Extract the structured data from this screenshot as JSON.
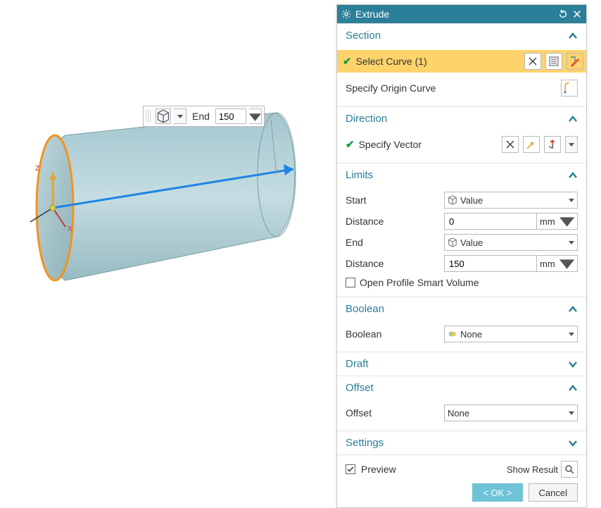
{
  "floatbox": {
    "label": "End",
    "value": "150",
    "icon": "cube-icon"
  },
  "dialog": {
    "title": "Extrude",
    "section": {
      "title": "Section",
      "expanded": true,
      "selectCurve": {
        "label": "Select Curve (1)"
      },
      "originCurve": {
        "label": "Specify Origin Curve"
      }
    },
    "direction": {
      "title": "Direction",
      "expanded": true,
      "specifyVector": {
        "label": "Specify Vector"
      }
    },
    "limits": {
      "title": "Limits",
      "expanded": true,
      "start": {
        "label": "Start",
        "type": "Value"
      },
      "startDistance": {
        "label": "Distance",
        "value": "0",
        "unit": "mm"
      },
      "end": {
        "label": "End",
        "type": "Value"
      },
      "endDistance": {
        "label": "Distance",
        "value": "150",
        "unit": "mm"
      },
      "openProfile": {
        "label": "Open Profile Smart Volume",
        "checked": false
      }
    },
    "boolean": {
      "title": "Boolean",
      "expanded": true,
      "label": "Boolean",
      "value": "None"
    },
    "draft": {
      "title": "Draft",
      "expanded": false
    },
    "offset": {
      "title": "Offset",
      "expanded": true,
      "label": "Offset",
      "value": "None"
    },
    "settings": {
      "title": "Settings",
      "expanded": false
    },
    "footer": {
      "preview": {
        "label": "Preview",
        "checked": true
      },
      "showResult": "Show Result",
      "ok": "< OK >",
      "cancel": "Cancel"
    }
  }
}
